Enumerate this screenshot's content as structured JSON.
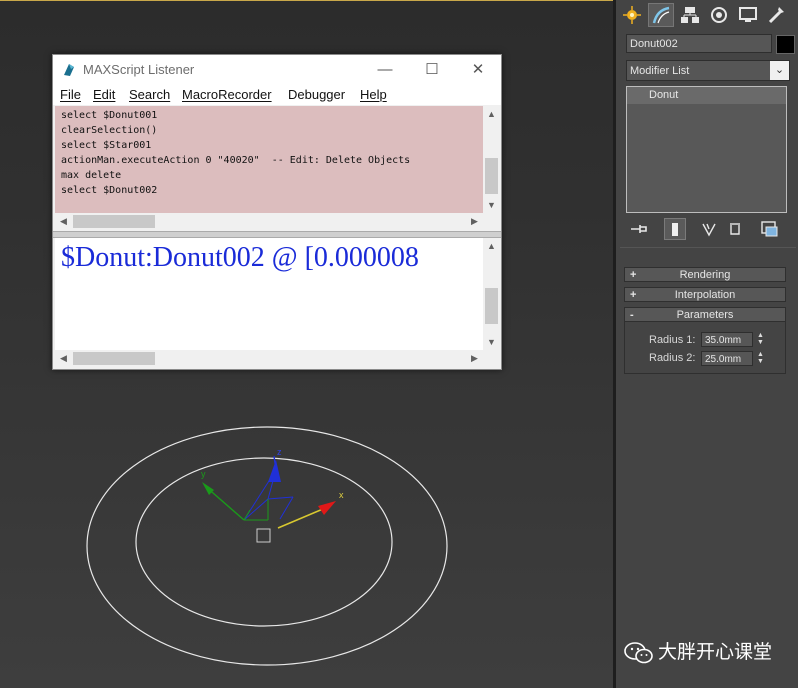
{
  "listener": {
    "title": "MAXScript Listener",
    "menus": [
      "File",
      "Edit",
      "Search",
      "MacroRecorder",
      "Debugger",
      "Help"
    ],
    "macro_lines": [
      "select $Donut001",
      "clearSelection()",
      "select $Star001",
      "actionMan.executeAction 0 \"40020\"  -- Edit: Delete Objects",
      "max delete",
      "select $Donut002"
    ],
    "output_text": "$Donut:Donut002 @ [0.000008",
    "window_buttons": {
      "minimize": "—",
      "maximize": "☐",
      "close": "✕"
    }
  },
  "panel": {
    "object_name": "Donut002",
    "object_color": "#000000",
    "modifier_list": "Modifier List",
    "stack_items": [
      "Donut"
    ],
    "rollouts": [
      {
        "sign": "+",
        "label": "Rendering"
      },
      {
        "sign": "+",
        "label": "Interpolation"
      },
      {
        "sign": "-",
        "label": "Parameters"
      }
    ],
    "params": {
      "radius1_label": "Radius 1:",
      "radius1_value": "35.0mm",
      "radius2_label": "Radius 2:",
      "radius2_value": "25.0mm"
    },
    "tabs": [
      "create-icon",
      "modify-icon",
      "hierarchy-icon",
      "motion-icon",
      "display-icon",
      "utilities-icon"
    ]
  },
  "viewport": {
    "gizmo_labels": {
      "x": "x",
      "y": "y",
      "z": "z"
    }
  },
  "watermark": {
    "text": "大胖开心课堂"
  },
  "colors": {
    "viewport_bg": "#303030",
    "macro_bg": "#dcbdbe",
    "output_text": "#1a2bd8",
    "axis_x": "#e01818",
    "axis_y": "#1a9a1a",
    "axis_z": "#2030d8"
  }
}
